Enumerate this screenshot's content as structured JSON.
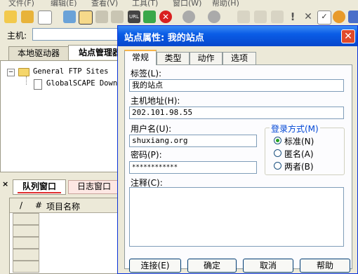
{
  "menubar": {
    "items": [
      "文件(F)",
      "编辑(E)",
      "查看(V)",
      "工具(T)",
      "窗口(W)",
      "帮助(H)"
    ]
  },
  "toolbar": {
    "icons": [
      "connect-icon",
      "wizard-icon",
      "new-file-icon",
      "disconnect-icon",
      "edit-icon",
      "hammer-icon",
      "url-icon",
      "refresh-icon",
      "stop-icon",
      "download-icon",
      "upload-icon",
      "properties-icon",
      "queue-icon",
      "exclaim-icon",
      "close-icon",
      "check-icon",
      "settings-icon",
      "options-icon"
    ]
  },
  "host": {
    "label": "主机:",
    "value": ""
  },
  "left_tabs": {
    "local": "本地驱动器",
    "site_manager": "站点管理器"
  },
  "tree": {
    "root": "General FTP Sites",
    "child": "GlobalSCAPE Downl"
  },
  "queue_tabs": {
    "close": "×",
    "queue": "队列窗口",
    "log": "日志窗口"
  },
  "queue_header": {
    "col_slash": "/",
    "col_num": "#",
    "col_name": "项目名称"
  },
  "dialog": {
    "title": "站点属性: 我的站点",
    "close": "✕",
    "tabs": [
      "常规",
      "类型",
      "动作",
      "选项"
    ],
    "fields": {
      "label_label": "标签(L):",
      "label_value": "我的站点",
      "host_label": "主机地址(H):",
      "host_value": "202.101.98.55",
      "user_label": "用户名(U):",
      "user_value": "shuxiang.org",
      "password_label": "密码(P):",
      "password_value": "************",
      "comment_label": "注释(C):"
    },
    "login": {
      "title": "登录方式(M)",
      "options": [
        "标准(N)",
        "匿名(A)",
        "两者(B)"
      ],
      "selected": "标准(N)"
    },
    "buttons": {
      "connect": "连接(E)",
      "ok": "确定",
      "cancel": "取消",
      "help": "帮助"
    }
  }
}
